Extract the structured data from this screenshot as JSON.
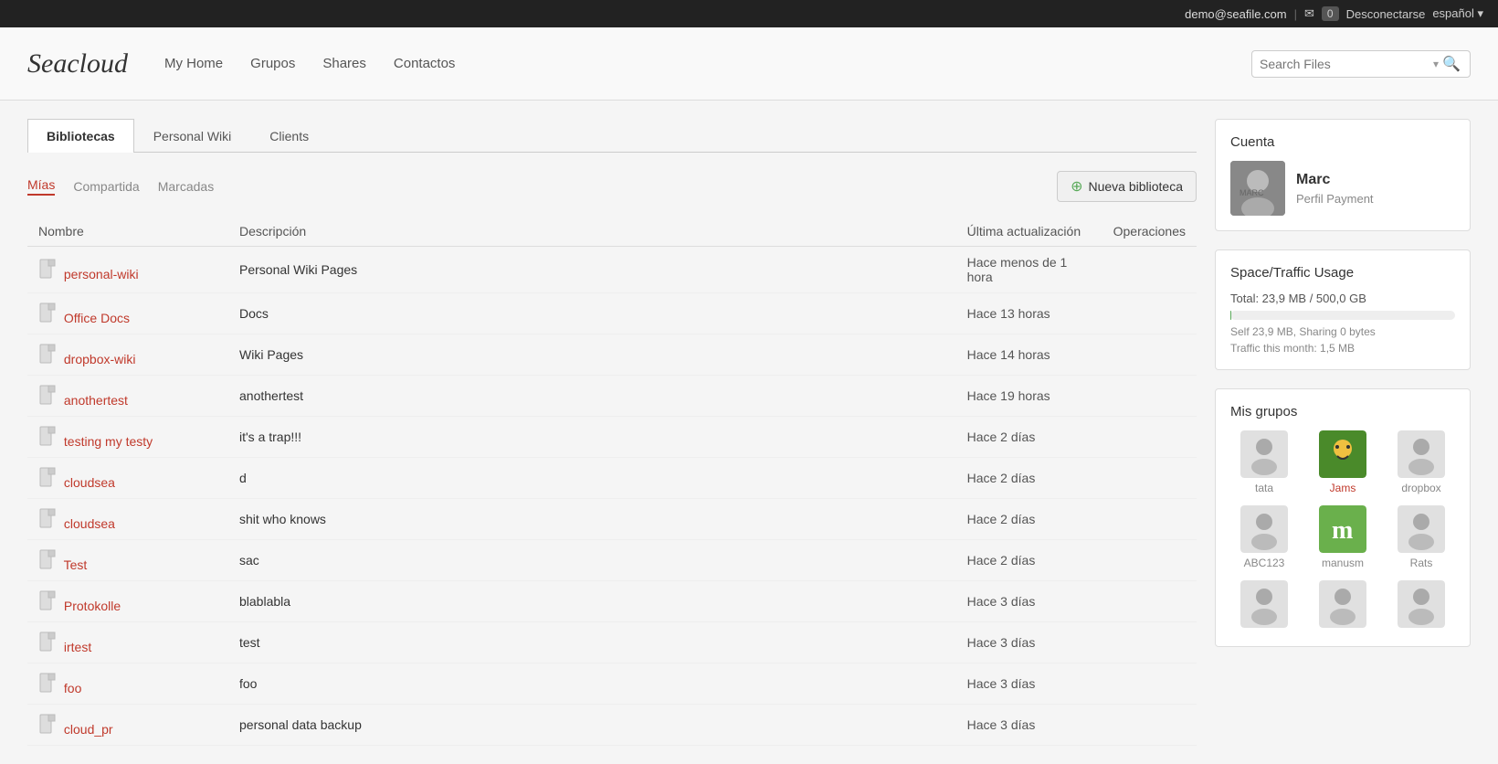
{
  "topbar": {
    "email": "demo@seafile.com",
    "mail_icon": "✉",
    "badge": "0",
    "logout": "Desconectarse",
    "lang": "español ▾"
  },
  "header": {
    "logo": "Seacloud",
    "nav": [
      {
        "label": "My Home",
        "id": "my-home"
      },
      {
        "label": "Grupos",
        "id": "grupos"
      },
      {
        "label": "Shares",
        "id": "shares"
      },
      {
        "label": "Contactos",
        "id": "contactos"
      }
    ],
    "search_placeholder": "Search Files"
  },
  "tabs": [
    {
      "label": "Bibliotecas",
      "id": "bibliotecas",
      "active": true
    },
    {
      "label": "Personal Wiki",
      "id": "personal-wiki"
    },
    {
      "label": "Clients",
      "id": "clients"
    }
  ],
  "subnav": [
    {
      "label": "Mías",
      "id": "mias",
      "active": true
    },
    {
      "label": "Compartida",
      "id": "compartida"
    },
    {
      "label": "Marcadas",
      "id": "marcadas"
    }
  ],
  "new_library_btn": "Nueva biblioteca",
  "table": {
    "headers": [
      "Nombre",
      "Descripción",
      "Última actualización",
      "Operaciones"
    ],
    "rows": [
      {
        "icon": "file",
        "name": "personal-wiki",
        "desc": "Personal Wiki Pages",
        "updated": "Hace menos de 1 hora"
      },
      {
        "icon": "file",
        "name": "Office Docs",
        "desc": "Docs",
        "updated": "Hace 13 horas"
      },
      {
        "icon": "file",
        "name": "dropbox-wiki",
        "desc": "Wiki Pages",
        "updated": "Hace 14 horas"
      },
      {
        "icon": "file",
        "name": "anothertest",
        "desc": "anothertest",
        "updated": "Hace 19 horas"
      },
      {
        "icon": "file",
        "name": "testing my testy",
        "desc": "it's a trap!!!",
        "updated": "Hace 2 días"
      },
      {
        "icon": "file",
        "name": "cloudsea",
        "desc": "d",
        "updated": "Hace 2 días"
      },
      {
        "icon": "file",
        "name": "cloudsea",
        "desc": "shit who knows",
        "updated": "Hace 2 días"
      },
      {
        "icon": "file",
        "name": "Test",
        "desc": "sac",
        "updated": "Hace 2 días"
      },
      {
        "icon": "file",
        "name": "Protokolle",
        "desc": "blablabla",
        "updated": "Hace 3 días"
      },
      {
        "icon": "file",
        "name": "irtest",
        "desc": "test",
        "updated": "Hace 3 días"
      },
      {
        "icon": "file",
        "name": "foo",
        "desc": "foo",
        "updated": "Hace 3 días"
      },
      {
        "icon": "file",
        "name": "cloud_pr",
        "desc": "personal data backup",
        "updated": "Hace 3 días"
      }
    ]
  },
  "sidebar": {
    "account_title": "Cuenta",
    "user_name": "Marc",
    "user_sub": "Perfil Payment",
    "space_title": "Space/Traffic Usage",
    "total": "Total: 23,9 MB / 500,0 GB",
    "self_sharing": "Self 23,9 MB, Sharing 0 bytes",
    "traffic": "Traffic this month: 1,5 MB",
    "usage_pct": 0.005,
    "groups_title": "Mis grupos",
    "groups": [
      {
        "name": "tata",
        "type": "generic",
        "active": false
      },
      {
        "name": "Jams",
        "type": "jams",
        "active": true
      },
      {
        "name": "dropbox",
        "type": "generic",
        "active": false
      },
      {
        "name": "ABC123",
        "type": "generic",
        "active": false
      },
      {
        "name": "manusm",
        "type": "manus",
        "active": false
      },
      {
        "name": "Rats",
        "type": "generic",
        "active": false
      },
      {
        "name": "",
        "type": "generic",
        "active": false
      },
      {
        "name": "",
        "type": "generic",
        "active": false
      },
      {
        "name": "",
        "type": "generic",
        "active": false
      }
    ]
  }
}
